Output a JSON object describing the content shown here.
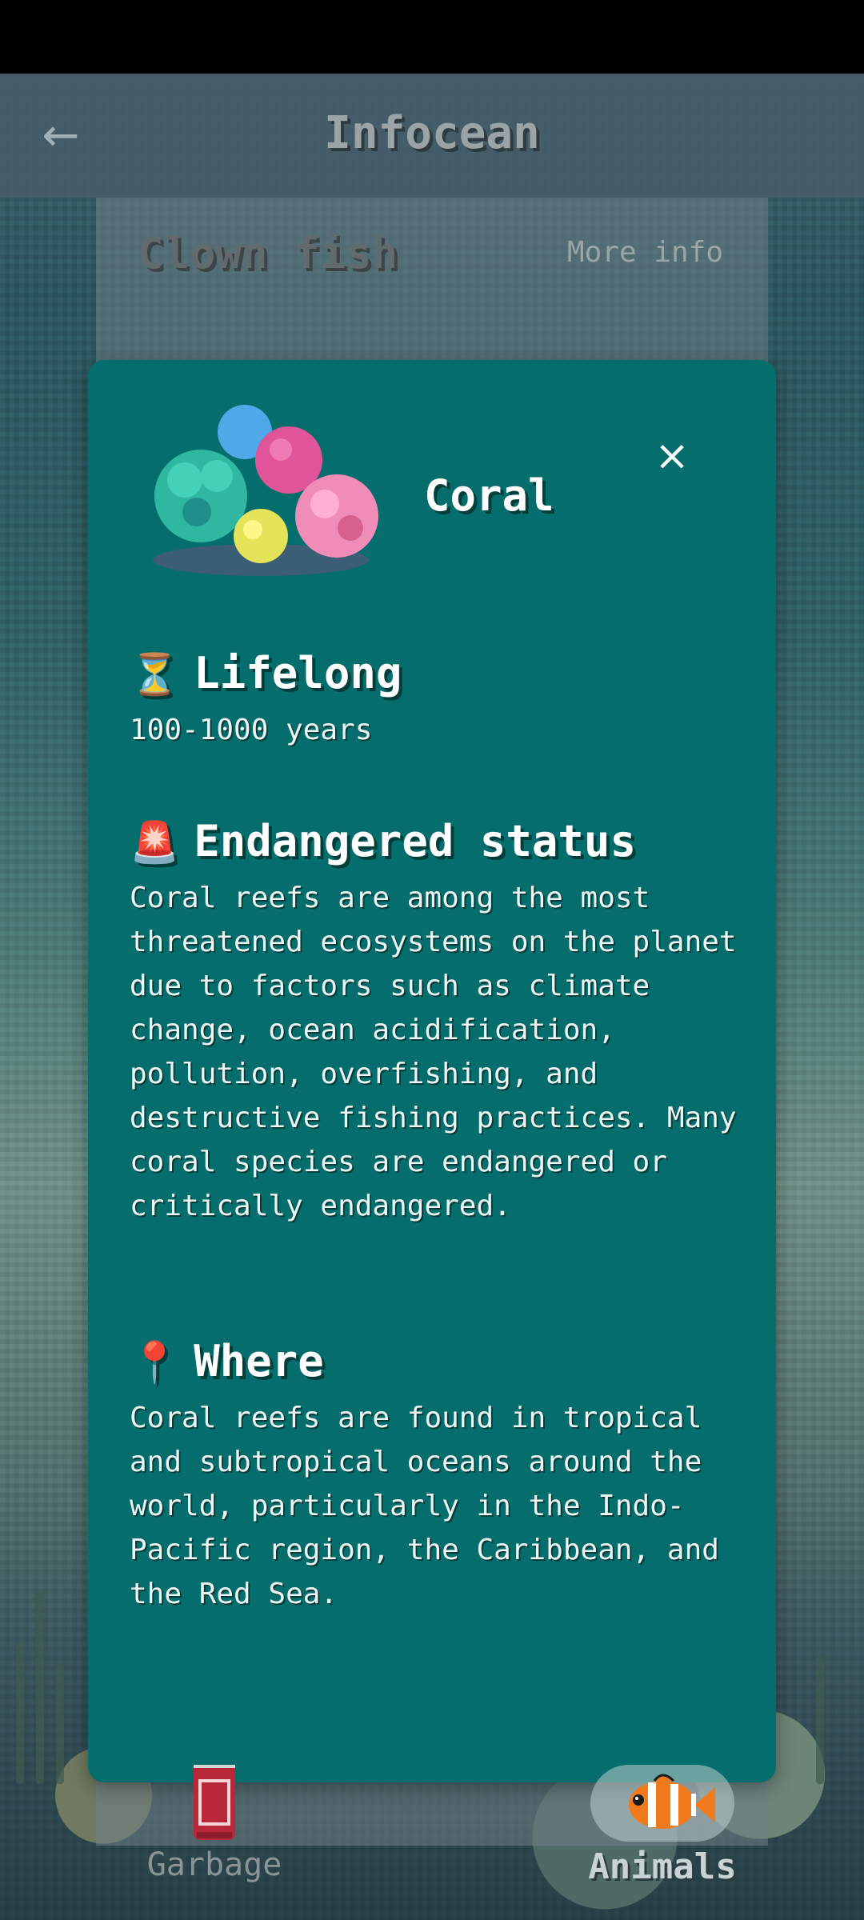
{
  "header": {
    "title": "Infocean",
    "back_icon": "←"
  },
  "background_card": {
    "title": "Clown fish",
    "more_info": "More info"
  },
  "modal": {
    "title": "Coral",
    "close_icon": "×",
    "sections": [
      {
        "emoji": "⏳",
        "heading": "Lifelong",
        "body": "100-1000 years"
      },
      {
        "emoji": "🚨",
        "heading": "Endangered status",
        "body": "Coral reefs are among the most threatened ecosystems on the planet due to factors such as climate change, ocean acidification, pollution, overfishing, and destructive fishing practices. Many coral species are endangered or critically endangered."
      },
      {
        "emoji": "📍",
        "heading": "Where",
        "body": "Coral reefs are found in tropical and subtropical oceans around the world, particularly in the Indo-Pacific region, the Caribbean, and the Red Sea."
      }
    ]
  },
  "bottom_nav": {
    "items": [
      {
        "label": "Garbage",
        "icon": "soda-can-icon",
        "active": false
      },
      {
        "label": "Animals",
        "icon": "clownfish-icon",
        "active": true
      }
    ]
  }
}
